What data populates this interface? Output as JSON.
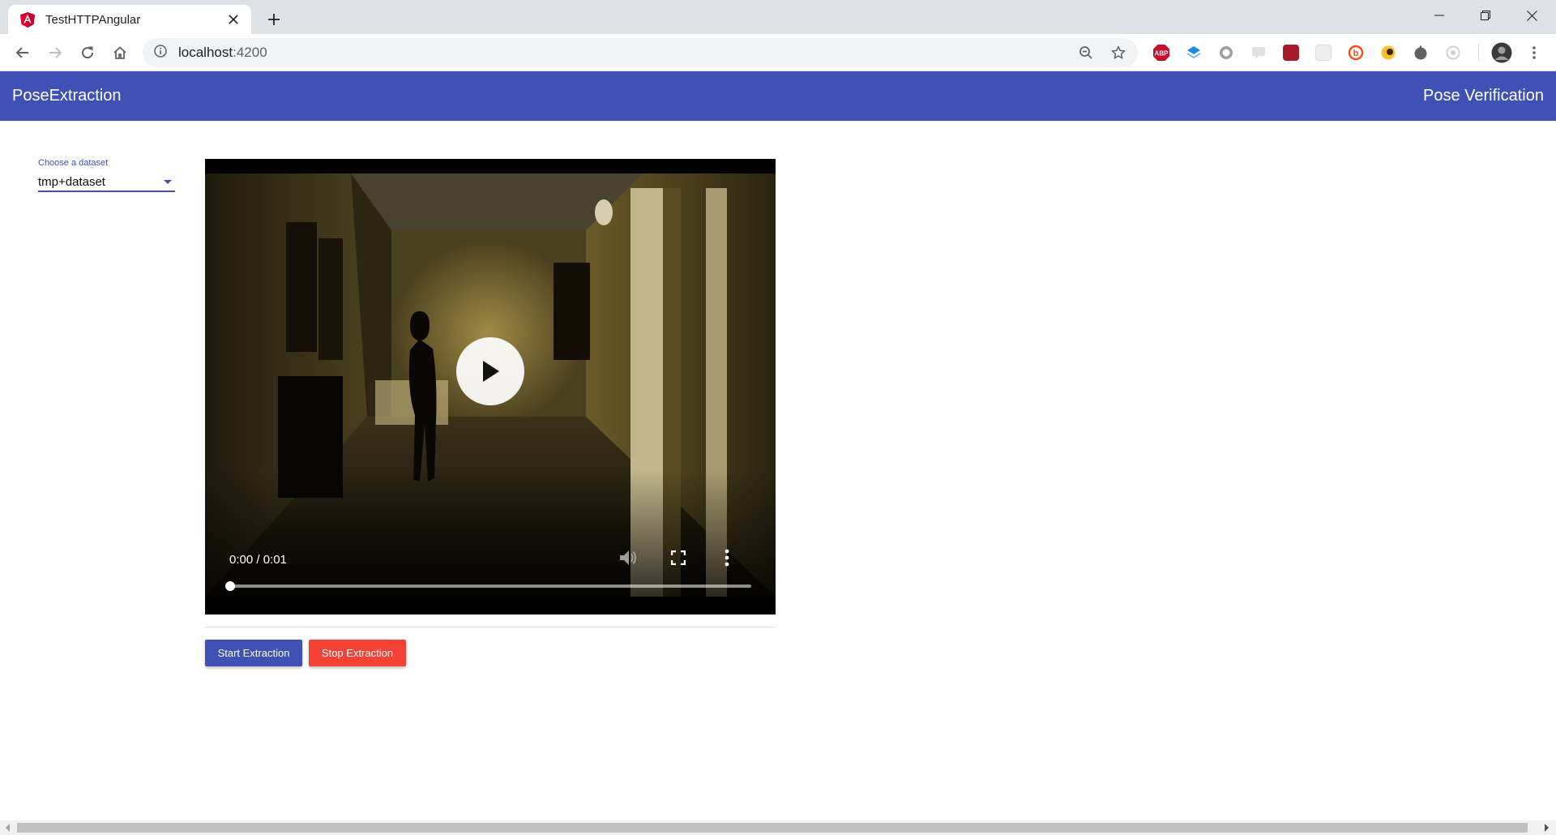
{
  "browser": {
    "tab_title": "TestHTTPAngular",
    "tab_icon": "angular-icon",
    "url_host": "localhost",
    "url_port": ":4200",
    "extensions": [
      "adblock-plus-icon",
      "extension-blue-icon",
      "extension-circle-icon",
      "extension-chat-icon",
      "extension-red-icon",
      "extension-white-icon",
      "extension-orange-icon",
      "extension-yellow-icon",
      "extension-dark-icon",
      "extension-grey-icon"
    ]
  },
  "header": {
    "brand": "PoseExtraction",
    "nav_link": "Pose Verification",
    "color": "#3f51b5"
  },
  "dataset_select": {
    "label": "Choose a dataset",
    "value": "tmp+dataset"
  },
  "video": {
    "time": "0:00 / 0:01",
    "progress": 0
  },
  "actions": {
    "start_label": "Start Extraction",
    "stop_label": "Stop Extraction",
    "start_color": "#3f51b5",
    "stop_color": "#f44336"
  }
}
